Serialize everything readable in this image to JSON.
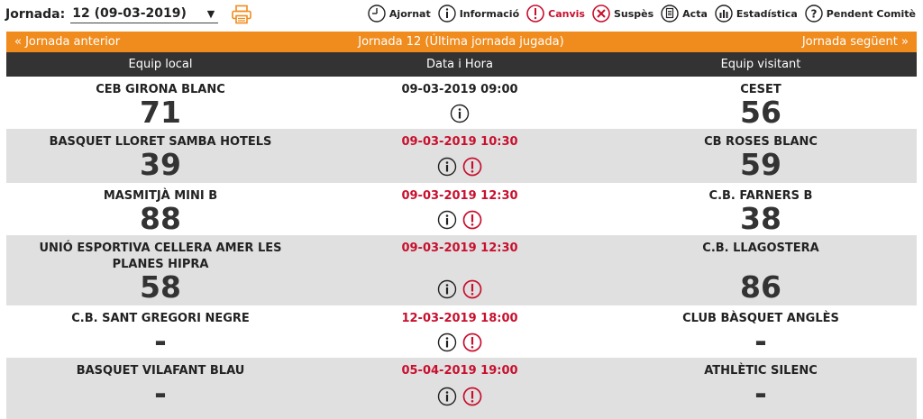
{
  "jornada": {
    "label": "Jornada:",
    "selected": "12 (09-03-2019)"
  },
  "legend": [
    {
      "icon": "clock-icon",
      "label": "Ajornat"
    },
    {
      "icon": "info-icon",
      "label": "Informació"
    },
    {
      "icon": "alert-icon",
      "label": "Canvis"
    },
    {
      "icon": "cross-icon",
      "label": "Suspès"
    },
    {
      "icon": "document-icon",
      "label": "Acta"
    },
    {
      "icon": "bar-chart-icon",
      "label": "Estadística"
    },
    {
      "icon": "question-icon",
      "label": "Pendent Comitè"
    }
  ],
  "nav": {
    "prev": "«  Jornada anterior",
    "current": "Jornada 12 (Última jornada jugada)",
    "next": "Jornada següent  »"
  },
  "columns": {
    "home": "Equip local",
    "date": "Data i Hora",
    "away": "Equip visitant"
  },
  "colors": {
    "orange": "#f08c1e",
    "dark": "#333333",
    "red": "#c8102e",
    "gray_row": "#e0e0e0"
  },
  "matches": [
    {
      "home": "CEB GIRONA BLANC",
      "home_score": "71",
      "date": "09-03-2019 09:00",
      "changed": false,
      "away": "CESET",
      "away_score": "56"
    },
    {
      "home": "BASQUET LLORET SAMBA HOTELS",
      "home_score": "39",
      "date": "09-03-2019 10:30",
      "changed": true,
      "away": "CB ROSES BLANC",
      "away_score": "59"
    },
    {
      "home": "MASMITJÀ MINI B",
      "home_score": "88",
      "date": "09-03-2019 12:30",
      "changed": true,
      "away": "C.B. FARNERS B",
      "away_score": "38"
    },
    {
      "home": "UNIÓ ESPORTIVA CELLERA AMER LES PLANES HIPRA",
      "home_score": "58",
      "date": "09-03-2019 12:30",
      "changed": true,
      "away": "C.B. LLAGOSTERA",
      "away_score": "86"
    },
    {
      "home": "C.B. SANT GREGORI NEGRE",
      "home_score": "-",
      "date": "12-03-2019 18:00",
      "changed": true,
      "away": "CLUB BÀSQUET ANGLÈS",
      "away_score": "-"
    },
    {
      "home": "BASQUET VILAFANT BLAU",
      "home_score": "-",
      "date": "05-04-2019 19:00",
      "changed": true,
      "away": "ATHLÈTIC SILENC",
      "away_score": "-"
    }
  ]
}
